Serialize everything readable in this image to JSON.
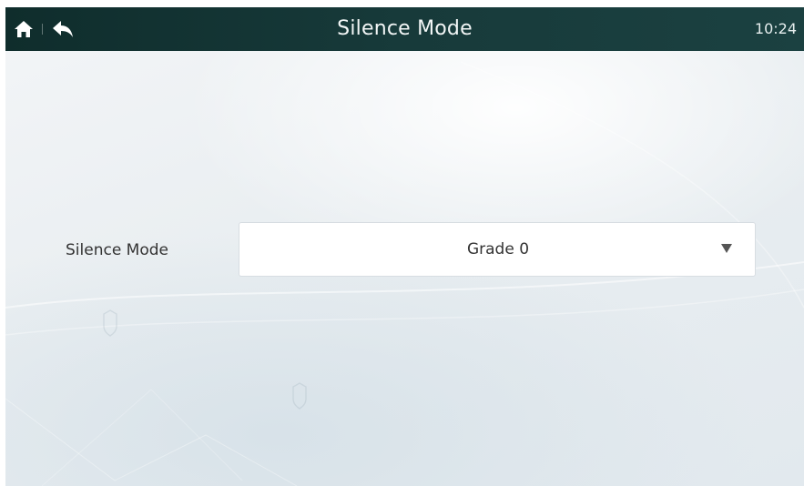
{
  "header": {
    "title": "Silence Mode",
    "time": "10:24",
    "home_icon": "home-icon",
    "back_icon": "back-arrow-icon"
  },
  "form": {
    "label": "Silence Mode",
    "select": {
      "value": "Grade 0",
      "arrow_icon": "dropdown-triangle-icon"
    }
  },
  "colors": {
    "topbar": "#173a3a",
    "background": "#e9eef1",
    "text": "#333333",
    "select_bg": "#ffffff"
  }
}
